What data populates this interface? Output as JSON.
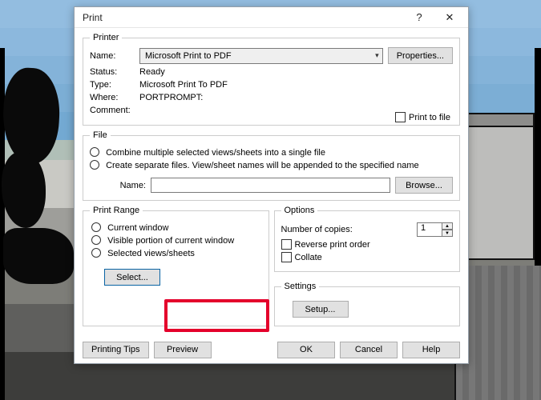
{
  "dialog": {
    "title": "Print"
  },
  "printer": {
    "group": "Printer",
    "name_label": "Name:",
    "name_value": "Microsoft Print to PDF",
    "properties_label": "Properties...",
    "status_label": "Status:",
    "status_value": "Ready",
    "type_label": "Type:",
    "type_value": "Microsoft Print To PDF",
    "where_label": "Where:",
    "where_value": "PORTPROMPT:",
    "comment_label": "Comment:",
    "print_to_file_label": "Print to file"
  },
  "file": {
    "group": "File",
    "combine_label": "Combine multiple selected views/sheets into a single file",
    "separate_label": "Create separate files. View/sheet names will be appended to the specified name",
    "name_label": "Name:",
    "name_value": "",
    "browse_label": "Browse..."
  },
  "range": {
    "group": "Print Range",
    "current_window": "Current window",
    "visible_portion": "Visible portion of current window",
    "selected_views": "Selected views/sheets",
    "select_label": "Select..."
  },
  "options": {
    "group": "Options",
    "copies_label": "Number of copies:",
    "copies_value": "1",
    "reverse_label": "Reverse print order",
    "collate_label": "Collate"
  },
  "settings": {
    "group": "Settings",
    "setup_label": "Setup..."
  },
  "footer": {
    "printing_tips": "Printing Tips",
    "preview": "Preview",
    "ok": "OK",
    "cancel": "Cancel",
    "help": "Help"
  }
}
